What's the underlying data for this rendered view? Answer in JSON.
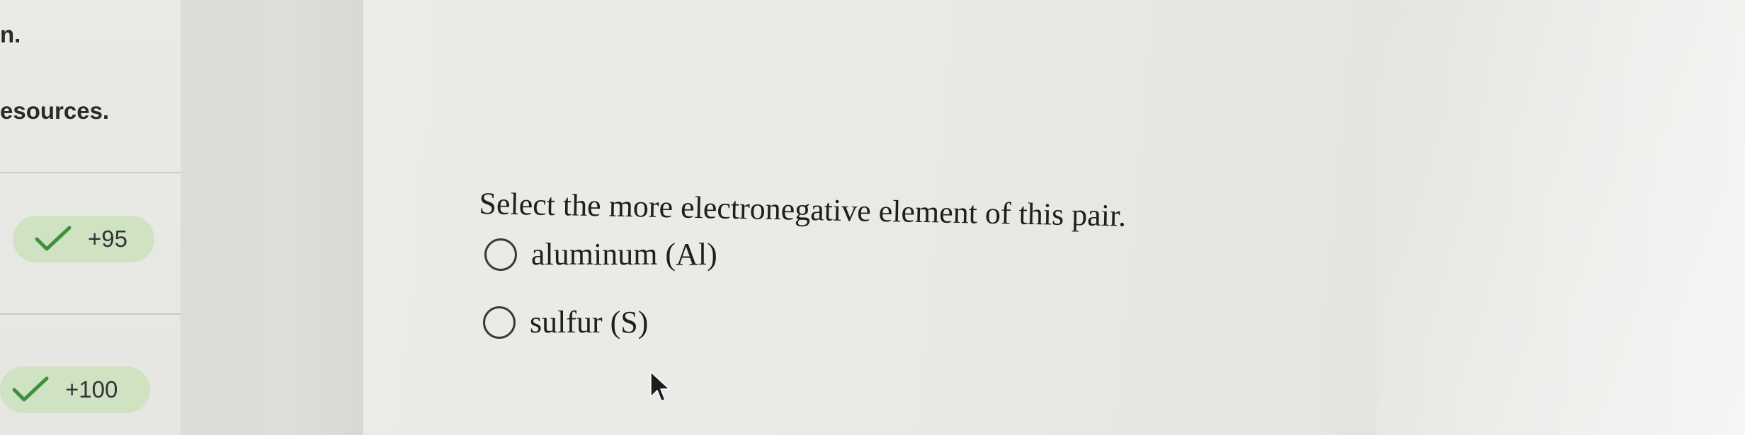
{
  "sidebar": {
    "fragments": [
      "n.",
      "esources."
    ],
    "scores": [
      {
        "label": "+95",
        "icon": "checkmark-icon"
      },
      {
        "label": "+100",
        "icon": "checkmark-icon"
      }
    ],
    "badge_color": "#cfe2c1",
    "check_color": "#3f8f3f"
  },
  "question": {
    "prompt": "Select the more electronegative element of this pair.",
    "options": [
      {
        "label": "aluminum (Al)",
        "selected": false
      },
      {
        "label": "sulfur (S)",
        "selected": false
      }
    ]
  },
  "pointer": {
    "icon": "mouse-cursor-icon"
  }
}
